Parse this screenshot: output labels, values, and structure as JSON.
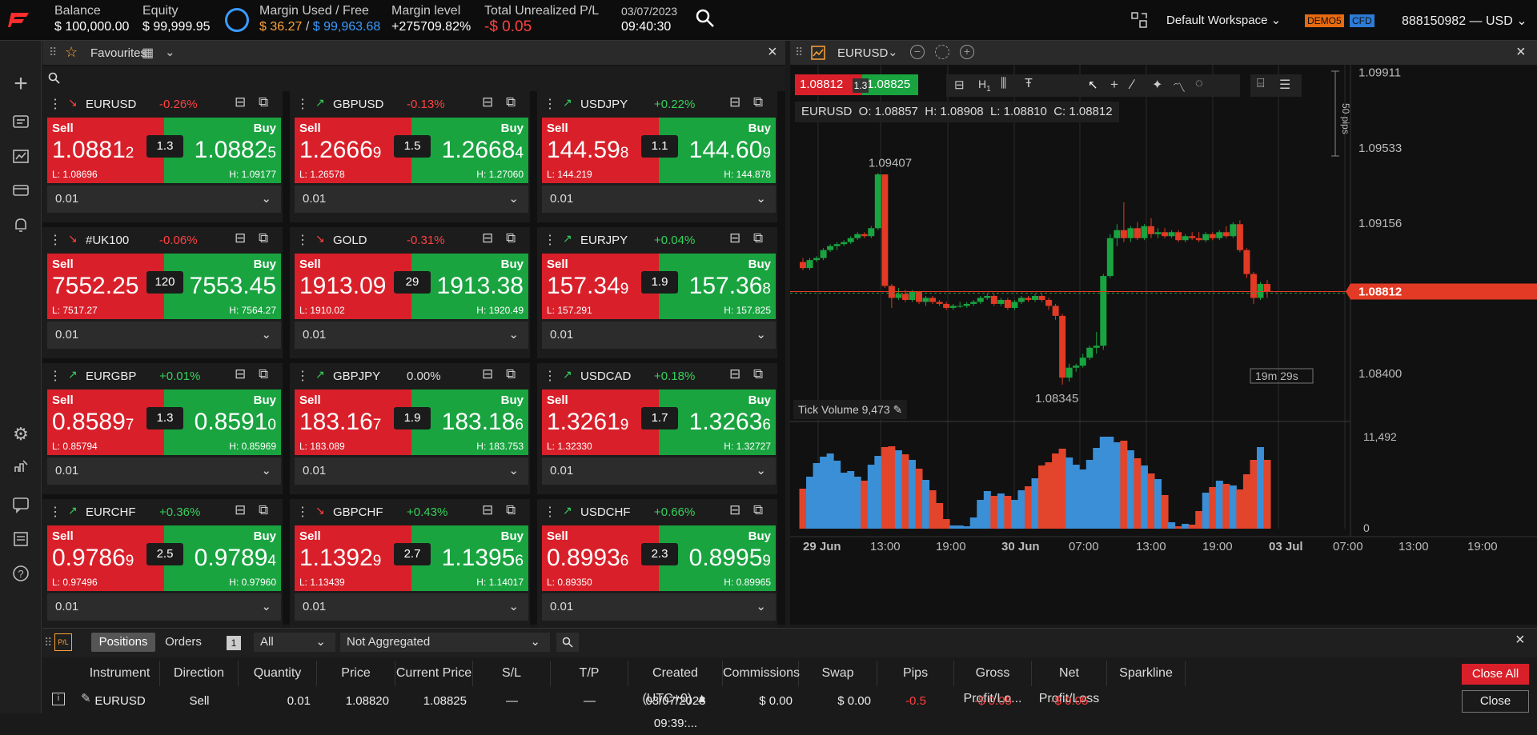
{
  "top": {
    "balance_label": "Balance",
    "balance": "$ 100,000.00",
    "equity_label": "Equity",
    "equity": "$ 99,999.95",
    "margin_label": "Margin Used / Free",
    "margin_used": "$ 36.27",
    "margin_sep": " / ",
    "margin_free": "$ 99,963.68",
    "margin_level_label": "Margin level",
    "margin_level": "+275709.82%",
    "upl_label": "Total Unrealized P/L",
    "upl": "-$ 0.05",
    "date": "03/07/2023",
    "time": "09:40:30",
    "workspace": "Default Workspace",
    "demo": "DEMO5",
    "cfd": "CFD",
    "account": "888150982 — USD",
    "colors": {
      "accent": "#ff2d2d",
      "margin_used": "#ffa33a",
      "margin_free": "#3a9bff"
    }
  },
  "favourites": {
    "title": "Favourites"
  },
  "cards": [
    {
      "sym": "EURUSD",
      "chg": "-0.26%",
      "dir": "down",
      "sell_main": "1.0881",
      "sell_pip": "2",
      "buy_main": "1.0882",
      "buy_pip": "5",
      "spread": "1.3",
      "low": "L: 1.08696",
      "high": "H: 1.09177",
      "lot": "0.01"
    },
    {
      "sym": "GBPUSD",
      "chg": "-0.13%",
      "dir": "up",
      "sell_main": "1.2666",
      "sell_pip": "9",
      "buy_main": "1.2668",
      "buy_pip": "4",
      "spread": "1.5",
      "low": "L: 1.26578",
      "high": "H: 1.27060",
      "lot": "0.01"
    },
    {
      "sym": "USDJPY",
      "chg": "+0.22%",
      "dir": "up",
      "sell_main": "144.59",
      "sell_pip": "8",
      "buy_main": "144.60",
      "buy_pip": "9",
      "spread": "1.1",
      "low": "L: 144.219",
      "high": "H: 144.878",
      "lot": "0.01"
    },
    {
      "sym": "#UK100",
      "chg": "-0.06%",
      "dir": "down",
      "sell_main": "7552.25",
      "sell_pip": "",
      "buy_main": "7553.45",
      "buy_pip": "",
      "spread": "120",
      "low": "L: 7517.27",
      "high": "H: 7564.27",
      "lot": "0.01"
    },
    {
      "sym": "GOLD",
      "chg": "-0.31%",
      "dir": "down",
      "sell_main": "1913.09",
      "sell_pip": "",
      "buy_main": "1913.38",
      "buy_pip": "",
      "spread": "29",
      "low": "L: 1910.02",
      "high": "H: 1920.49",
      "lot": "0.01"
    },
    {
      "sym": "EURJPY",
      "chg": "+0.04%",
      "dir": "up",
      "sell_main": "157.34",
      "sell_pip": "9",
      "buy_main": "157.36",
      "buy_pip": "8",
      "spread": "1.9",
      "low": "L: 157.291",
      "high": "H: 157.825",
      "lot": "0.01"
    },
    {
      "sym": "EURGBP",
      "chg": "+0.01%",
      "dir": "up",
      "sell_main": "0.8589",
      "sell_pip": "7",
      "buy_main": "0.8591",
      "buy_pip": "0",
      "spread": "1.3",
      "low": "L: 0.85794",
      "high": "H: 0.85969",
      "lot": "0.01"
    },
    {
      "sym": "GBPJPY",
      "chg": "0.00%",
      "dir": "up",
      "sell_main": "183.16",
      "sell_pip": "7",
      "buy_main": "183.18",
      "buy_pip": "6",
      "spread": "1.9",
      "low": "L: 183.089",
      "high": "H: 183.753",
      "lot": "0.01"
    },
    {
      "sym": "USDCAD",
      "chg": "+0.18%",
      "dir": "up",
      "sell_main": "1.3261",
      "sell_pip": "9",
      "buy_main": "1.3263",
      "buy_pip": "6",
      "spread": "1.7",
      "low": "L: 1.32330",
      "high": "H: 1.32727",
      "lot": "0.01"
    },
    {
      "sym": "EURCHF",
      "chg": "+0.36%",
      "dir": "up",
      "sell_main": "0.9786",
      "sell_pip": "9",
      "buy_main": "0.9789",
      "buy_pip": "4",
      "spread": "2.5",
      "low": "L: 0.97496",
      "high": "H: 0.97960",
      "lot": "0.01"
    },
    {
      "sym": "GBPCHF",
      "chg": "+0.43%",
      "dir": "down",
      "sell_main": "1.1392",
      "sell_pip": "9",
      "buy_main": "1.1395",
      "buy_pip": "6",
      "spread": "2.7",
      "low": "L: 1.13439",
      "high": "H: 1.14017",
      "lot": "0.01"
    },
    {
      "sym": "USDCHF",
      "chg": "+0.66%",
      "dir": "up",
      "sell_main": "0.8993",
      "sell_pip": "6",
      "buy_main": "0.8995",
      "buy_pip": "9",
      "spread": "2.3",
      "low": "L: 0.89350",
      "high": "H: 0.89965",
      "lot": "0.01"
    }
  ],
  "labels": {
    "sell": "Sell",
    "buy": "Buy"
  },
  "chart": {
    "symbol": "EURUSD",
    "bid": "1.08812",
    "spread": "1.3",
    "ask": "1.08825",
    "ohlc": "EURUSD  O: 1.08857  H: 1.08908  L: 1.08810  C: 1.08812",
    "timeframe": "H",
    "timeframe_sub": "1",
    "high_label": "1.09407",
    "low_label": "1.08345",
    "price_ticks": [
      "1.09911",
      "1.09533",
      "1.09156",
      "1.08400"
    ],
    "current_price": "1.08812",
    "pips_label": "50 pips",
    "countdown": "19m 29s",
    "volume_title": "Tick Volume 9,473",
    "vol_ticks": [
      "11,492",
      "0"
    ],
    "time_ticks": [
      "29 Jun",
      "13:00",
      "19:00",
      "30 Jun",
      "07:00",
      "13:00",
      "19:00",
      "03 Jul",
      "07:00",
      "13:00",
      "19:00"
    ]
  },
  "chart_data": {
    "type": "candlestick",
    "candles": [
      [
        1.0896,
        1.0898,
        1.0892,
        1.0893
      ],
      [
        1.0893,
        1.0898,
        1.0892,
        1.0897
      ],
      [
        1.0897,
        1.0899,
        1.0896,
        1.0898
      ],
      [
        1.0898,
        1.0903,
        1.0897,
        1.0902
      ],
      [
        1.0902,
        1.0905,
        1.0901,
        1.0904
      ],
      [
        1.0904,
        1.0906,
        1.0902,
        1.0905
      ],
      [
        1.0905,
        1.0907,
        1.0904,
        1.0906
      ],
      [
        1.0906,
        1.0909,
        1.0905,
        1.0908
      ],
      [
        1.0908,
        1.0911,
        1.0907,
        1.091
      ],
      [
        1.091,
        1.0911,
        1.0908,
        1.0909
      ],
      [
        1.0909,
        1.0914,
        1.0908,
        1.0913
      ],
      [
        1.0913,
        1.09407,
        1.0912,
        1.094
      ],
      [
        1.094,
        1.094,
        1.0883,
        1.0884
      ],
      [
        1.0884,
        1.0885,
        1.0873,
        1.0878
      ],
      [
        1.0878,
        1.0883,
        1.0877,
        1.088
      ],
      [
        1.088,
        1.0882,
        1.0876,
        1.0877
      ],
      [
        1.0877,
        1.0882,
        1.0876,
        1.0881
      ],
      [
        1.0881,
        1.0881,
        1.0875,
        1.0876
      ],
      [
        1.0876,
        1.0879,
        1.0874,
        1.0878
      ],
      [
        1.0878,
        1.0879,
        1.0875,
        1.0876
      ],
      [
        1.0876,
        1.0877,
        1.0874,
        1.0875
      ],
      [
        1.0875,
        1.0876,
        1.0872,
        1.0873
      ],
      [
        1.0873,
        1.0875,
        1.0872,
        1.0874
      ],
      [
        1.0874,
        1.0876,
        1.0873,
        1.0874
      ],
      [
        1.0874,
        1.0876,
        1.0873,
        1.0875
      ],
      [
        1.0875,
        1.0877,
        1.0874,
        1.0876
      ],
      [
        1.0876,
        1.0879,
        1.0875,
        1.0878
      ],
      [
        1.0878,
        1.088,
        1.0877,
        1.0879
      ],
      [
        1.0879,
        1.088,
        1.0874,
        1.0875
      ],
      [
        1.0875,
        1.0878,
        1.0874,
        1.0877
      ],
      [
        1.0877,
        1.0878,
        1.0872,
        1.0873
      ],
      [
        1.0873,
        1.0877,
        1.0872,
        1.0876
      ],
      [
        1.0876,
        1.0879,
        1.0875,
        1.0878
      ],
      [
        1.0878,
        1.0879,
        1.0876,
        1.0877
      ],
      [
        1.0877,
        1.088,
        1.0876,
        1.0879
      ],
      [
        1.0879,
        1.088,
        1.0876,
        1.0877
      ],
      [
        1.0877,
        1.0878,
        1.0872,
        1.0874
      ],
      [
        1.0874,
        1.0875,
        1.0867,
        1.0869
      ],
      [
        1.0869,
        1.087,
        1.08345,
        1.0838
      ],
      [
        1.0838,
        1.0845,
        1.0836,
        1.0843
      ],
      [
        1.0843,
        1.0845,
        1.0841,
        1.0844
      ],
      [
        1.0844,
        1.085,
        1.0843,
        1.0848
      ],
      [
        1.0848,
        1.0854,
        1.0847,
        1.0853
      ],
      [
        1.0853,
        1.0861,
        1.085,
        1.0854
      ],
      [
        1.0854,
        1.089,
        1.0852,
        1.0889
      ],
      [
        1.0889,
        1.091,
        1.0888,
        1.0908
      ],
      [
        1.0908,
        1.0915,
        1.0904,
        1.0912
      ],
      [
        1.0912,
        1.0926,
        1.0906,
        1.0908
      ],
      [
        1.0908,
        1.0914,
        1.0906,
        1.0913
      ],
      [
        1.0913,
        1.0916,
        1.0907,
        1.0908
      ],
      [
        1.0908,
        1.0915,
        1.0907,
        1.0914
      ],
      [
        1.0914,
        1.0918,
        1.0908,
        1.091
      ],
      [
        1.091,
        1.0913,
        1.0908,
        1.0911
      ],
      [
        1.0911,
        1.0913,
        1.0908,
        1.0909
      ],
      [
        1.0909,
        1.0912,
        1.0908,
        1.0911
      ],
      [
        1.0911,
        1.0912,
        1.0906,
        1.0907
      ],
      [
        1.0907,
        1.091,
        1.0906,
        1.0909
      ],
      [
        1.0909,
        1.0911,
        1.0907,
        1.0908
      ],
      [
        1.0908,
        1.0911,
        1.0906,
        1.0907
      ],
      [
        1.0907,
        1.0911,
        1.0906,
        1.091
      ],
      [
        1.091,
        1.0911,
        1.0907,
        1.0908
      ],
      [
        1.0908,
        1.0912,
        1.0907,
        1.0911
      ],
      [
        1.0911,
        1.0914,
        1.0908,
        1.0909
      ],
      [
        1.0909,
        1.0916,
        1.0908,
        1.0915
      ],
      [
        1.0915,
        1.0917,
        1.0901,
        1.0902
      ],
      [
        1.0902,
        1.0903,
        1.0888,
        1.089
      ],
      [
        1.089,
        1.0891,
        1.0875,
        1.0878
      ],
      [
        1.0878,
        1.0886,
        1.0877,
        1.0885
      ],
      [
        1.0885,
        1.0887,
        1.0878,
        1.0881
      ]
    ],
    "volumes": [
      5000,
      6500,
      8200,
      9000,
      9400,
      8500,
      7000,
      7200,
      6500,
      6000,
      8000,
      9100,
      10200,
      10300,
      9800,
      9300,
      8600,
      7500,
      6100,
      4800,
      3200,
      1200,
      400,
      400,
      300,
      1400,
      3600,
      4700,
      4100,
      4400,
      4100,
      3600,
      4800,
      5300,
      6300,
      7900,
      8300,
      9400,
      10000,
      8900,
      8000,
      7400,
      8600,
      10100,
      11500,
      11500,
      10800,
      11000,
      9800,
      8800,
      7900,
      6900,
      6200,
      4200,
      800,
      300,
      600,
      500,
      2200,
      4500,
      5200,
      6000,
      5600,
      5400,
      4900,
      6800,
      8600,
      10200,
      8600
    ],
    "price_range": [
      1.082,
      1.0995
    ],
    "volume_range": [
      0,
      14000
    ]
  },
  "positions": {
    "tab_positions": "Positions",
    "tab_orders": "Orders",
    "count": "1",
    "filter_all": "All",
    "aggregation": "Not Aggregated",
    "columns": [
      "Instrument",
      "Direction",
      "Quantity",
      "Price",
      "Current Price",
      "S/L",
      "T/P",
      "Created (UTC+0) ▲",
      "Commissions",
      "Swap",
      "Pips",
      "Gross Profit/Lo...",
      "Net Profit/Loss",
      "Sparkline"
    ],
    "close_all": "Close All",
    "row": {
      "instrument": "EURUSD",
      "direction": "Sell",
      "quantity": "0.01",
      "price": "1.08820",
      "current": "1.08825",
      "sl": "—",
      "tp": "—",
      "created": "03/07/2023 09:39:...",
      "commissions": "$ 0.00",
      "swap": "$ 0.00",
      "pips": "-0.5",
      "gross": "-$ 0.05",
      "net": "-$ 0.05",
      "close": "Close"
    }
  }
}
